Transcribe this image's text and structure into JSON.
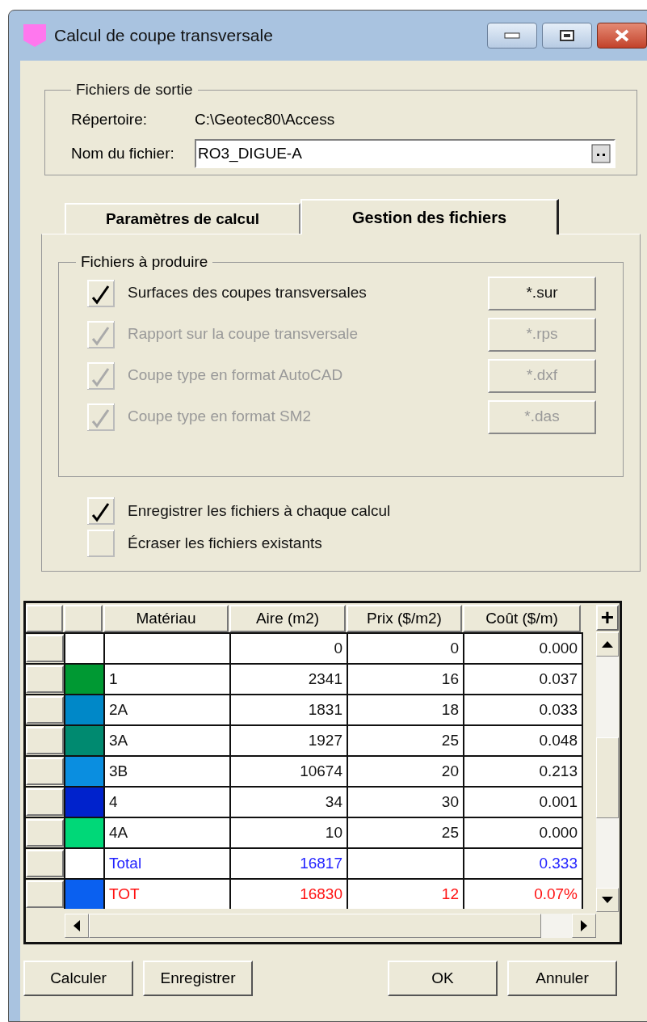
{
  "window": {
    "title": "Calcul de coupe transversale"
  },
  "output_files": {
    "legend": "Fichiers de sortie",
    "directory_label": "Répertoire:",
    "directory_value": "C:\\Geotec80\\Access",
    "filename_label": "Nom du fichier:",
    "filename_value": "RO3_DIGUE-A"
  },
  "tabs": [
    {
      "label": "Paramètres de calcul",
      "selected": false
    },
    {
      "label": "Gestion des fichiers",
      "selected": true
    }
  ],
  "files_group": {
    "legend": "Fichiers à produire",
    "items": [
      {
        "label": "Surfaces des coupes transversales",
        "checked": true,
        "disabled": false,
        "button": "*.sur"
      },
      {
        "label": "Rapport sur la coupe transversale",
        "checked": true,
        "disabled": true,
        "button": "*.rps"
      },
      {
        "label": "Coupe type en format AutoCAD",
        "checked": true,
        "disabled": true,
        "button": "*.dxf"
      },
      {
        "label": "Coupe type en format SM2",
        "checked": true,
        "disabled": true,
        "button": "*.das"
      }
    ]
  },
  "options": [
    {
      "label": "Enregistrer les fichiers à chaque calcul",
      "checked": true
    },
    {
      "label": "Écraser les fichiers existants",
      "checked": false
    }
  ],
  "table": {
    "columns": [
      "Matériau",
      "Aire (m2)",
      "Prix ($/m2)",
      "Coût ($/m)"
    ],
    "add_button": "+",
    "rows": [
      {
        "kind": "data",
        "color": "#ffffff",
        "cells": [
          "",
          "0",
          "0",
          "0.000"
        ]
      },
      {
        "kind": "data",
        "color": "#009933",
        "cells": [
          "1",
          "2341",
          "16",
          "0.037"
        ]
      },
      {
        "kind": "data",
        "color": "#0088c8",
        "cells": [
          "2A",
          "1831",
          "18",
          "0.033"
        ]
      },
      {
        "kind": "data",
        "color": "#008a70",
        "cells": [
          "3A",
          "1927",
          "25",
          "0.048"
        ]
      },
      {
        "kind": "data",
        "color": "#0a8ee0",
        "cells": [
          "3B",
          "10674",
          "20",
          "0.213"
        ]
      },
      {
        "kind": "data",
        "color": "#0022cc",
        "cells": [
          "4",
          "34",
          "30",
          "0.001"
        ]
      },
      {
        "kind": "data",
        "color": "#00d878",
        "cells": [
          "4A",
          "10",
          "25",
          "0.000"
        ]
      },
      {
        "kind": "total",
        "color": "#ffffff",
        "cells": [
          "Total",
          "16817",
          "",
          "0.333"
        ]
      },
      {
        "kind": "check",
        "color": "#0a60f0",
        "cells": [
          "TOT",
          "16830",
          "12",
          "0.07%"
        ]
      }
    ]
  },
  "buttons": [
    {
      "label": "Calculer",
      "kind": "left"
    },
    {
      "label": "Enregistrer",
      "kind": "left"
    },
    {
      "label": "OK",
      "kind": "right"
    },
    {
      "label": "Annuler",
      "kind": "right"
    }
  ]
}
